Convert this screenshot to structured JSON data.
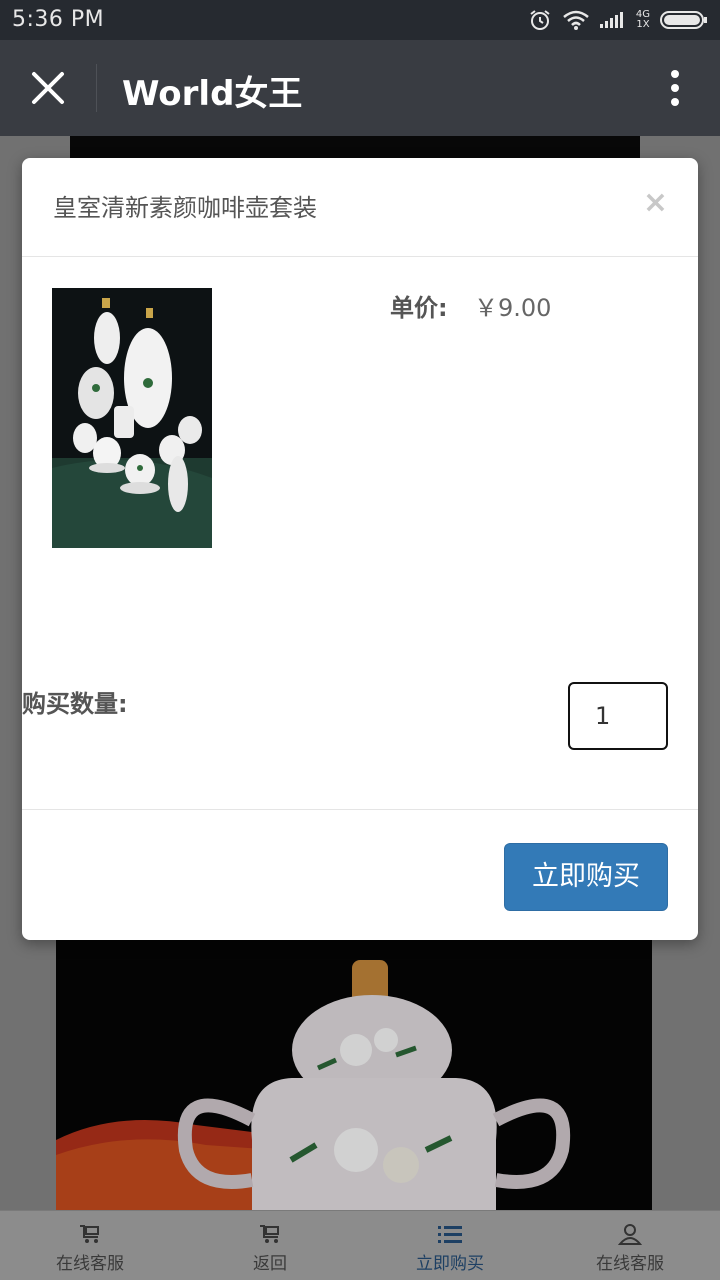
{
  "status_bar": {
    "time": "5:36 PM",
    "network_top": "4G",
    "network_bottom": "1X"
  },
  "title_bar": {
    "title": "World女王"
  },
  "modal": {
    "title": "皇室清新素颜咖啡壶套装",
    "close_glyph": "×",
    "price_label": "单价:",
    "price_value": "￥9.00",
    "quantity_label": "购买数量:",
    "quantity_value": "1",
    "buy_button": "立即购买"
  },
  "bottom_nav": {
    "items": [
      {
        "label": "在线客服",
        "icon": "cart-icon"
      },
      {
        "label": "返回",
        "icon": "cart-icon"
      },
      {
        "label": "立即购买",
        "icon": "list-icon"
      },
      {
        "label": "在线客服",
        "icon": "user-icon"
      }
    ]
  },
  "colors": {
    "title_bar": "#393c42",
    "status_bar": "#262a30",
    "buy_button": "#337ab7",
    "active_nav": "#1d3f63"
  }
}
